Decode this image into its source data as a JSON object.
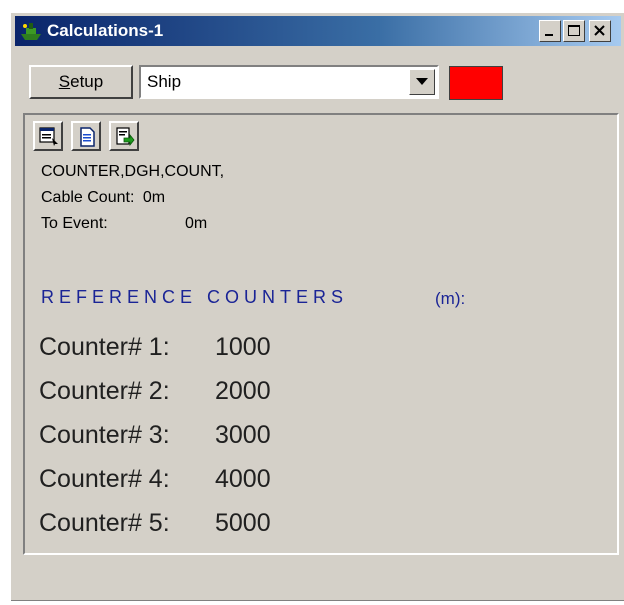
{
  "window": {
    "title": "Calculations-1",
    "buttons": [
      "minimize",
      "maximize",
      "close"
    ]
  },
  "toolbar": {
    "setup_label_underlined": "S",
    "setup_label_rest": "etup",
    "vessel_select_value": "Ship",
    "status_color": "#ff0000"
  },
  "icons": [
    "ship-icon",
    "window-settings-icon",
    "document-icon",
    "export-icon",
    "chevron-down-icon"
  ],
  "info": {
    "source": "COUNTER,DGH,COUNT,",
    "cable_count_label": "Cable Count:",
    "cable_count_value": "0m",
    "to_event_label": "To Event:",
    "to_event_value": "0m"
  },
  "reference": {
    "heading": "REFERENCE COUNTERS",
    "unit": "(m):",
    "counters": [
      {
        "label": "Counter# 1:",
        "value": "1000"
      },
      {
        "label": "Counter# 2:",
        "value": "2000"
      },
      {
        "label": "Counter# 3:",
        "value": "3000"
      },
      {
        "label": "Counter# 4:",
        "value": "4000"
      },
      {
        "label": "Counter# 5:",
        "value": "5000"
      }
    ]
  },
  "colors": {
    "title_bar": "#0a246a",
    "window_bg": "#d4d0c8",
    "heading_text": "#1a2496",
    "status_red": "#ff0000"
  }
}
